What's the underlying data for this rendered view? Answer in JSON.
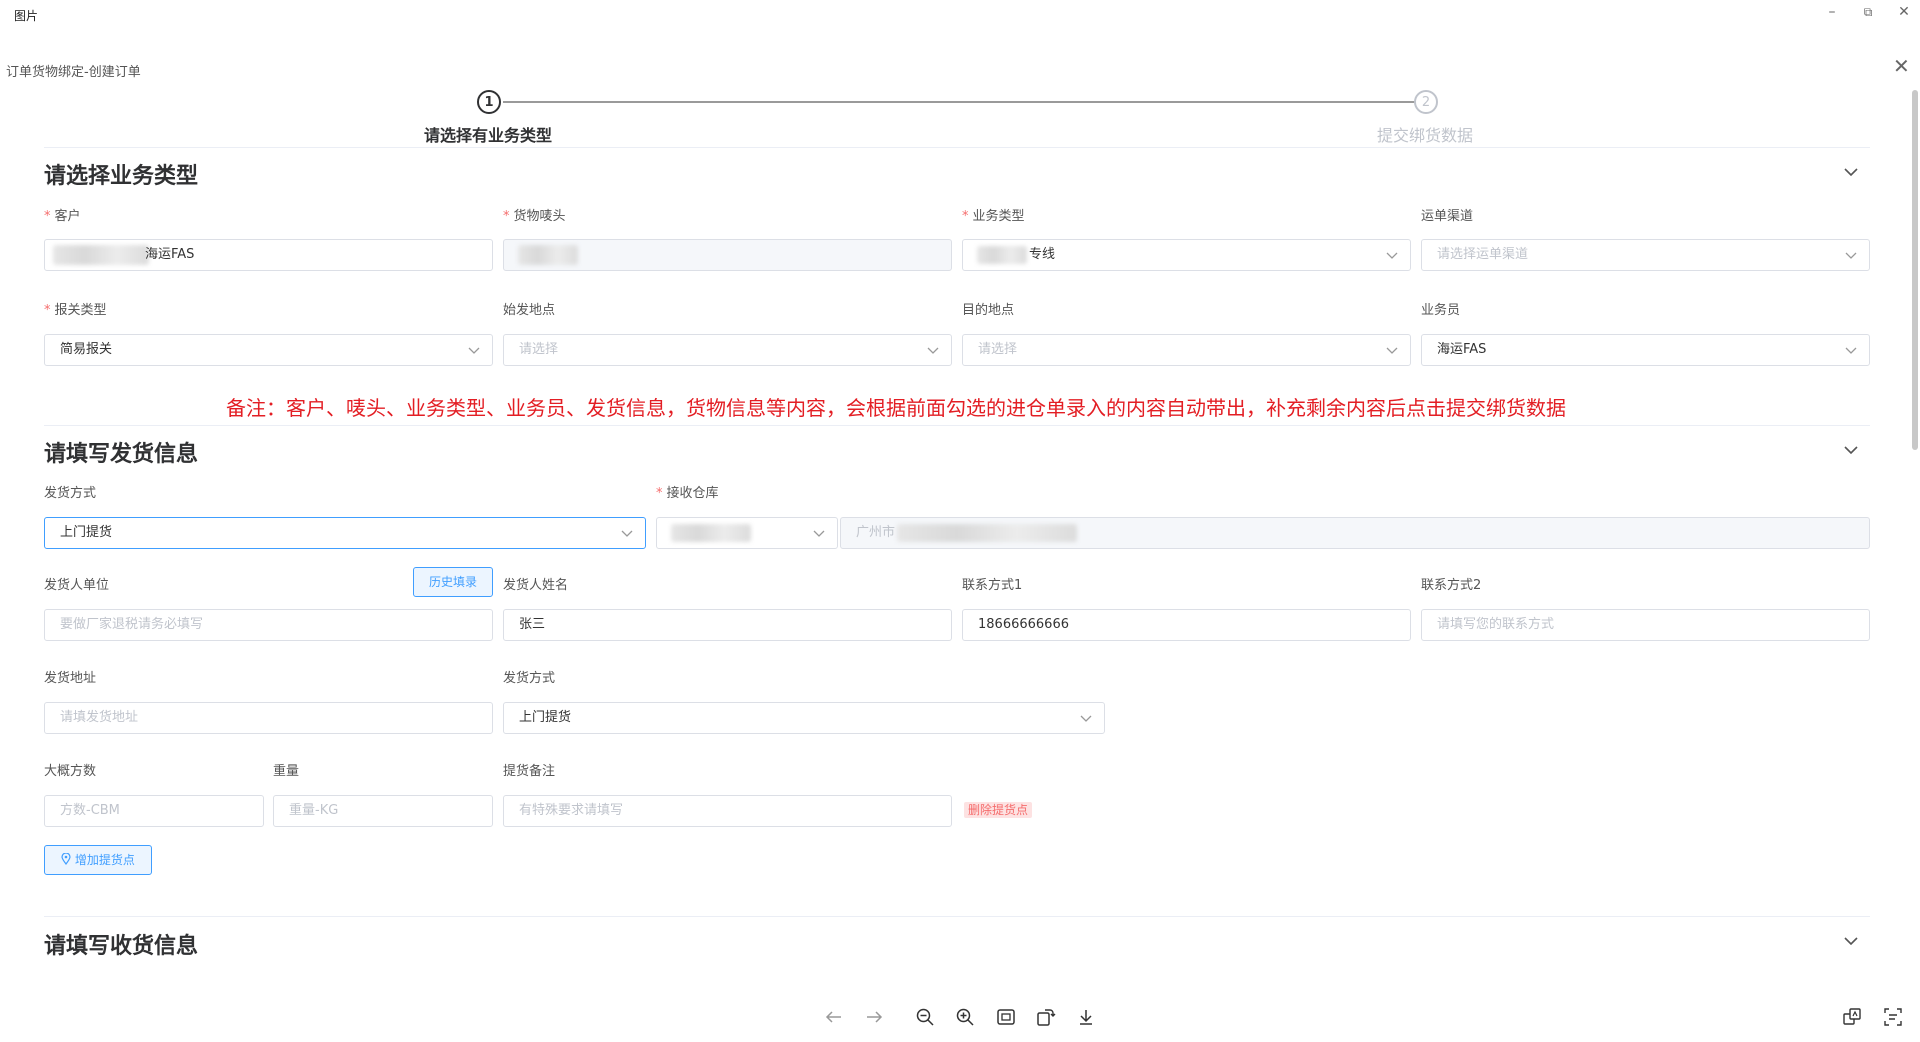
{
  "window": {
    "title": "图片"
  },
  "dialog": {
    "title": "订单货物绑定-创建订单"
  },
  "steps": [
    {
      "num": "1",
      "label": "请选择有业务类型"
    },
    {
      "num": "2",
      "label": "提交绑货数据"
    }
  ],
  "section1": {
    "title": "请选择业务类型",
    "customer": {
      "label": "客户",
      "value": "海运FAS"
    },
    "mark": {
      "label": "货物唛头"
    },
    "biz_type": {
      "label": "业务类型",
      "value": "专线"
    },
    "channel": {
      "label": "运单渠道",
      "placeholder": "请选择运单渠道"
    },
    "customs": {
      "label": "报关类型",
      "value": "简易报关"
    },
    "origin": {
      "label": "始发地点",
      "placeholder": "请选择"
    },
    "dest": {
      "label": "目的地点",
      "placeholder": "请选择"
    },
    "salesman": {
      "label": "业务员",
      "value": "海运FAS"
    }
  },
  "note": "备注：客户、唛头、业务类型、业务员、发货信息，货物信息等内容，会根据前面勾选的进仓单录入的内容自动带出，补充剩余内容后点击提交绑货数据",
  "section2": {
    "title": "请填写发货信息",
    "ship_method": {
      "label": "发货方式",
      "value": "上门提货"
    },
    "warehouse": {
      "label": "接收仓库",
      "address_prefix": "广州市"
    },
    "sender_unit": {
      "label": "发货人单位",
      "placeholder": "要做厂家退税请务必填写",
      "history_button": "历史填录"
    },
    "sender_name": {
      "label": "发货人姓名",
      "value": "张三"
    },
    "contact1": {
      "label": "联系方式1",
      "value": "18666666666"
    },
    "contact2": {
      "label": "联系方式2",
      "placeholder": "请填写您的联系方式"
    },
    "address": {
      "label": "发货地址",
      "placeholder": "请填发货地址"
    },
    "ship_method2": {
      "label": "发货方式",
      "value": "上门提货"
    },
    "volume": {
      "label": "大概方数",
      "placeholder": "方数-CBM"
    },
    "weight": {
      "label": "重量",
      "placeholder": "重量-KG"
    },
    "pickup_note": {
      "label": "提货备注",
      "placeholder": "有特殊要求请填写"
    },
    "delete_pickup": "删除提货点",
    "add_pickup": "增加提货点"
  },
  "section3": {
    "title": "请填写收货信息"
  },
  "colors": {
    "primary": "#409eff",
    "danger": "#f56c6c",
    "note": "#e31e24"
  }
}
